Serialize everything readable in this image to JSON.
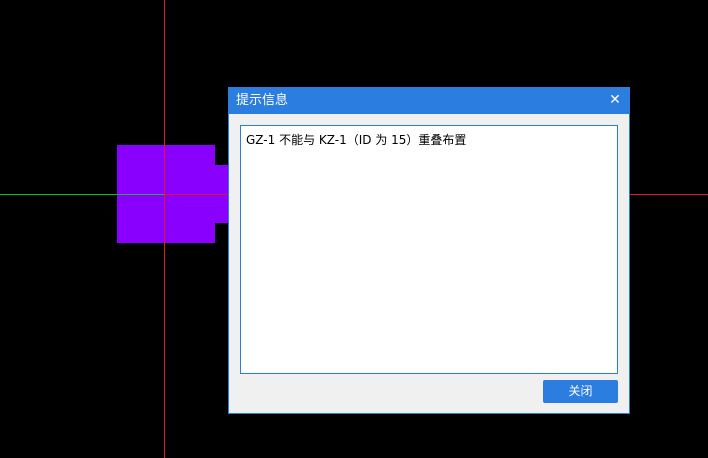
{
  "dialog": {
    "title": "提示信息",
    "close_icon_glyph": "✕",
    "message": "GZ-1 不能与 KZ-1（ID 为 15）重叠布置",
    "close_button_label": "关闭"
  },
  "colors": {
    "background": "#000000",
    "axis_red": "#e0191f",
    "axis_green": "#1fb51f",
    "shape_fill": "#8a00ff",
    "accent": "#2b7de0"
  },
  "icons": {
    "close": "close-icon"
  }
}
